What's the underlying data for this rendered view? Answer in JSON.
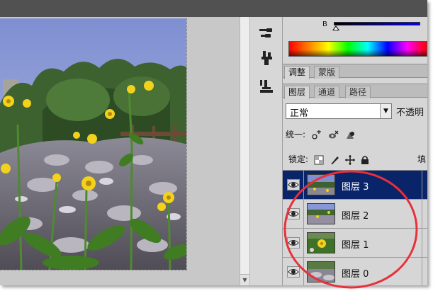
{
  "color_panel": {
    "channel_label": "B"
  },
  "panel_tabs": [
    {
      "label": "调整",
      "active": true
    },
    {
      "label": "蒙版",
      "active": false
    }
  ],
  "layers_tabs": [
    {
      "label": "图层",
      "active": true
    },
    {
      "label": "通道",
      "active": false
    },
    {
      "label": "路径",
      "active": false
    }
  ],
  "layers_panel": {
    "blend_mode": "正常",
    "opacity_label": "不透明",
    "unify_label": "统一:",
    "lock_label": "锁定:",
    "fill_label": "填"
  },
  "layers": [
    {
      "name": "图层 3",
      "selected": true,
      "visible": true
    },
    {
      "name": "图层 2",
      "selected": false,
      "visible": true
    },
    {
      "name": "图层 1",
      "selected": false,
      "visible": true
    },
    {
      "name": "图层 0",
      "selected": false,
      "visible": true
    }
  ],
  "tools": [
    "brush-preset-icon",
    "clone-source-icon",
    "tool-preset-icon"
  ],
  "colors": {
    "selection": "#0a246a",
    "annotation": "#e8303a",
    "top_bar": "#515151"
  }
}
